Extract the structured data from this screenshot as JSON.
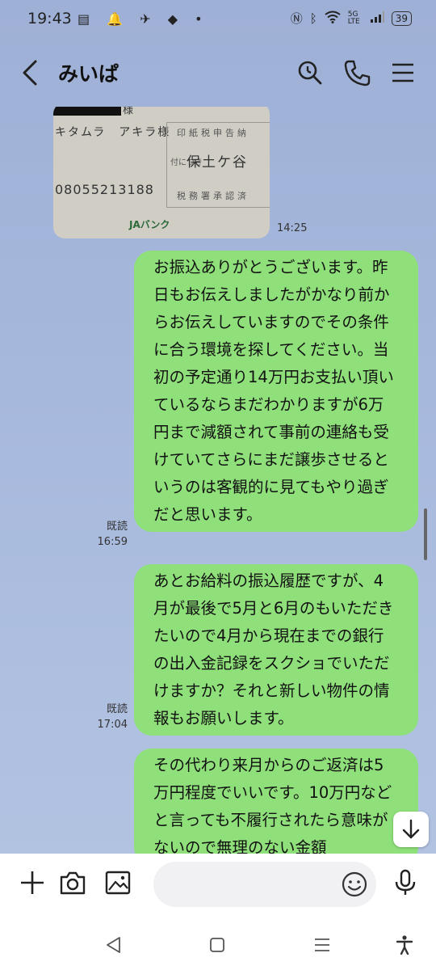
{
  "status_bar": {
    "time": "19:43",
    "notif_icons": "▤ 🔔 ✈ ◆ •",
    "net": "5G LTE",
    "battery": "39"
  },
  "header": {
    "title": "みいぱ"
  },
  "photo": {
    "suffix": "様",
    "name": "キタムラ　アキラ様",
    "number": "08055213188",
    "stamp_top": "印紙税申告納",
    "stamp_small": "付につき",
    "stamp_place": "保土ケ谷",
    "stamp_bottom": "税務署承認済",
    "bank": "JAバンク",
    "time": "14:25"
  },
  "messages": [
    {
      "text": "お振込ありがとうございます。昨日もお伝えしましたがかなり前からお伝えしていますのでその条件に合う環境を探してください。当初の予定通り14万円お支払い頂いているならまだわかりますが6万円まで減額されて事前の連絡も受けていてさらにまだ譲歩させるというのは客観的に見てもやり過ぎだと思います。",
      "read": "既読",
      "time": "16:59"
    },
    {
      "text": "あとお給料の振込履歴ですが、4月が最後で5月と6月のもいただきたいので4月から現在までの銀行の出入金記録をスクショでいただけますか？それと新しい物件の情報もお願いします。",
      "read": "既読",
      "time": "17:04"
    },
    {
      "text": "その代わり来月からのご返済は5万円程度でいいです。10万円などと言っても不履行されたら意味がないので無理のない金額",
      "read": "",
      "time": ""
    }
  ],
  "input": {
    "placeholder": ""
  }
}
